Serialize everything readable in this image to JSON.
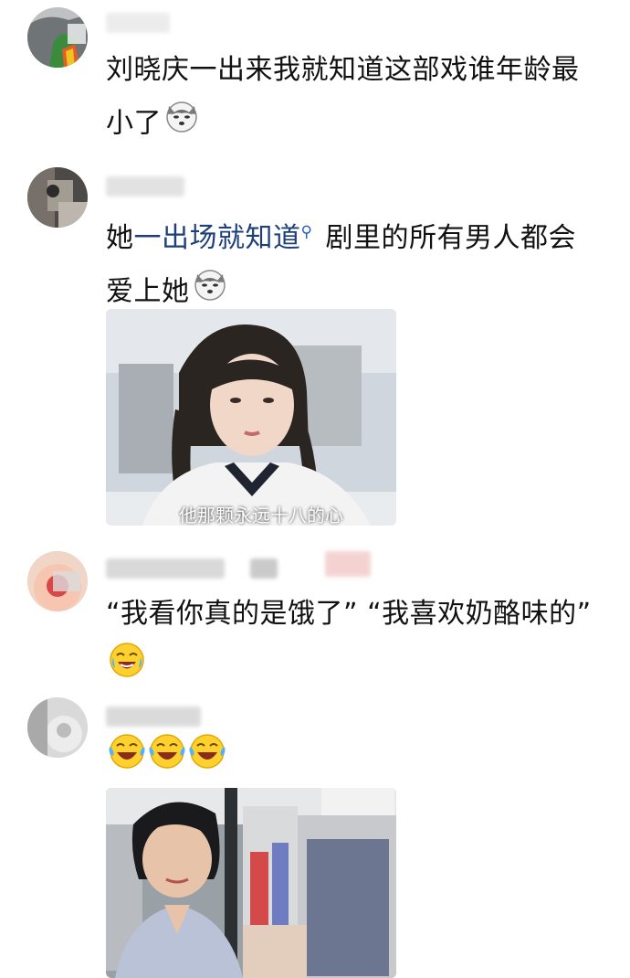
{
  "comments": [
    {
      "text": "刘晓庆一出来我就知道这部戏谁年龄最小了",
      "emoji": "doge-dog-icon"
    },
    {
      "text_before": "她",
      "link": "一出场就知道",
      "text_after": "剧里的所有男人都会爱上她",
      "emoji": "doge-dog-icon",
      "image": "photo-girl-with-braids",
      "image_subtitle": "他那颗永远十八的心"
    },
    {
      "text": "“我看你真的是饿了” “我喜欢奶酪味的”",
      "emoji": "crying-laughing-face-icon"
    },
    {
      "text": "",
      "emojis": [
        "laughing-crying-face-icon",
        "laughing-crying-face-icon",
        "laughing-crying-face-icon"
      ],
      "image": "photo-woman-in-store"
    }
  ],
  "colors": {
    "link": "#1f3f7a",
    "search_icon": "#1f5fc6",
    "text": "#111111"
  }
}
